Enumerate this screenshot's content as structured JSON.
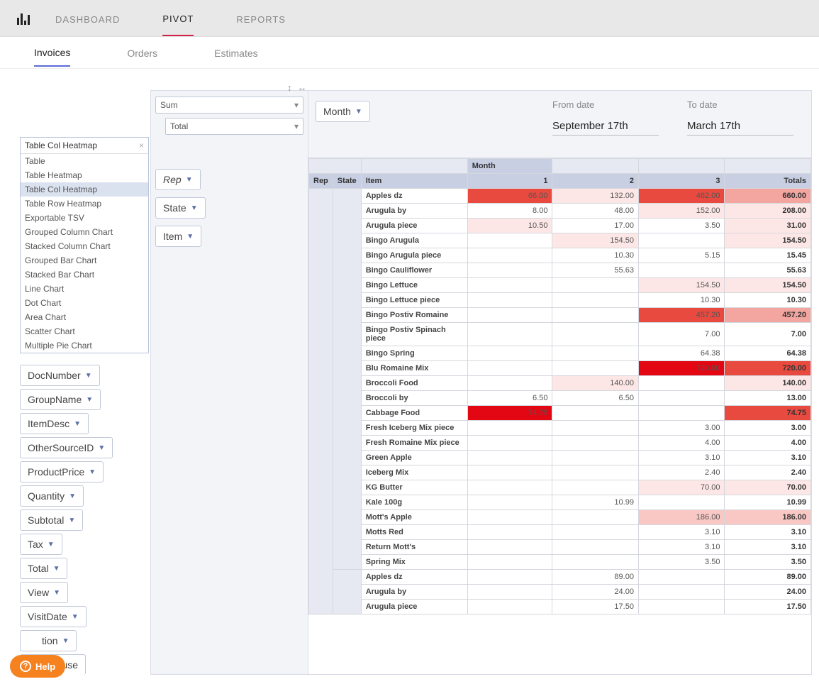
{
  "topnav": {
    "tabs": [
      "DASHBOARD",
      "PIVOT",
      "REPORTS"
    ],
    "active": 1
  },
  "subnav": {
    "tabs": [
      "Invoices",
      "Orders",
      "Estimates"
    ],
    "active": 0
  },
  "dates": {
    "from_label": "From date",
    "from_value": "September 17th",
    "to_label": "To date",
    "to_value": "March 17th"
  },
  "chart_type": {
    "selected": "Table Col Heatmap",
    "options": [
      "Table",
      "Table Heatmap",
      "Table Col Heatmap",
      "Table Row Heatmap",
      "Exportable TSV",
      "Grouped Column Chart",
      "Stacked Column Chart",
      "Grouped Bar Chart",
      "Stacked Bar Chart",
      "Line Chart",
      "Dot Chart",
      "Area Chart",
      "Scatter Chart",
      "Multiple Pie Chart"
    ],
    "highlight": 2
  },
  "available_fields": [
    "DocNumber",
    "GroupName",
    "ItemDesc",
    "OtherSourceID",
    "ProductPrice",
    "Quantity",
    "Subtotal",
    "Tax",
    "Total",
    "View",
    "VisitDate"
  ],
  "truncated_field": "tion",
  "cutoff_field": "Warehouse",
  "aggregator": {
    "func": "Sum",
    "field": "Total"
  },
  "row_fields": [
    "Rep",
    "State",
    "Item"
  ],
  "col_fields": [
    "Month"
  ],
  "pivot": {
    "month_label": "Month",
    "row_headers": [
      "Rep",
      "State",
      "Item"
    ],
    "cols": [
      "1",
      "2",
      "3"
    ],
    "totals_label": "Totals",
    "rows": [
      {
        "item": "Apples dz",
        "v": [
          "66.00",
          "132.00",
          "462.00"
        ],
        "t": "660.00",
        "h": [
          4,
          1,
          4
        ]
      },
      {
        "item": "Arugula by",
        "v": [
          "8.00",
          "48.00",
          "152.00"
        ],
        "t": "208.00",
        "h": [
          0,
          0,
          1
        ]
      },
      {
        "item": "Arugula piece",
        "v": [
          "10.50",
          "17.00",
          "3.50"
        ],
        "t": "31.00",
        "h": [
          1,
          0,
          0
        ]
      },
      {
        "item": "Bingo Arugula",
        "v": [
          "",
          "154.50",
          ""
        ],
        "t": "154.50",
        "h": [
          0,
          1,
          0
        ]
      },
      {
        "item": "Bingo Arugula piece",
        "v": [
          "",
          "10.30",
          "5.15"
        ],
        "t": "15.45",
        "h": [
          0,
          0,
          0
        ]
      },
      {
        "item": "Bingo Cauliflower",
        "v": [
          "",
          "55.63",
          ""
        ],
        "t": "55.63",
        "h": [
          0,
          0,
          0
        ]
      },
      {
        "item": "Bingo Lettuce",
        "v": [
          "",
          "",
          "154.50"
        ],
        "t": "154.50",
        "h": [
          0,
          0,
          1
        ]
      },
      {
        "item": "Bingo Lettuce piece",
        "v": [
          "",
          "",
          "10.30"
        ],
        "t": "10.30",
        "h": [
          0,
          0,
          0
        ]
      },
      {
        "item": "Bingo Postiv Romaine",
        "v": [
          "",
          "",
          "457.20"
        ],
        "t": "457.20",
        "h": [
          0,
          0,
          4
        ]
      },
      {
        "item": "Bingo Postiv Spinach piece",
        "v": [
          "",
          "",
          "7.00"
        ],
        "t": "7.00",
        "h": [
          0,
          0,
          0
        ]
      },
      {
        "item": "Bingo Spring",
        "v": [
          "",
          "",
          "64.38"
        ],
        "t": "64.38",
        "h": [
          0,
          0,
          0
        ]
      },
      {
        "item": "Blu Romaine Mix",
        "v": [
          "",
          "",
          "720.00"
        ],
        "t": "720.00",
        "h": [
          0,
          0,
          5
        ]
      },
      {
        "item": "Broccoli Food",
        "v": [
          "",
          "140.00",
          ""
        ],
        "t": "140.00",
        "h": [
          0,
          1,
          0
        ]
      },
      {
        "item": "Broccoli by",
        "v": [
          "6.50",
          "6.50",
          ""
        ],
        "t": "13.00",
        "h": [
          0,
          0,
          0
        ]
      },
      {
        "item": "Cabbage Food",
        "v": [
          "74.75",
          "",
          ""
        ],
        "t": "74.75",
        "h": [
          5,
          0,
          0
        ]
      },
      {
        "item": "Fresh Iceberg Mix piece",
        "v": [
          "",
          "",
          "3.00"
        ],
        "t": "3.00",
        "h": [
          0,
          0,
          0
        ]
      },
      {
        "item": "Fresh Romaine Mix piece",
        "v": [
          "",
          "",
          "4.00"
        ],
        "t": "4.00",
        "h": [
          0,
          0,
          0
        ]
      },
      {
        "item": "Green Apple",
        "v": [
          "",
          "",
          "3.10"
        ],
        "t": "3.10",
        "h": [
          0,
          0,
          0
        ]
      },
      {
        "item": "Iceberg Mix",
        "v": [
          "",
          "",
          "2.40"
        ],
        "t": "2.40",
        "h": [
          0,
          0,
          0
        ]
      },
      {
        "item": "KG Butter",
        "v": [
          "",
          "",
          "70.00"
        ],
        "t": "70.00",
        "h": [
          0,
          0,
          1
        ]
      },
      {
        "item": "Kale 100g",
        "v": [
          "",
          "10.99",
          ""
        ],
        "t": "10.99",
        "h": [
          0,
          0,
          0
        ]
      },
      {
        "item": "Mott's Apple",
        "v": [
          "",
          "",
          "186.00"
        ],
        "t": "186.00",
        "h": [
          0,
          0,
          2
        ]
      },
      {
        "item": "Motts Red",
        "v": [
          "",
          "",
          "3.10"
        ],
        "t": "3.10",
        "h": [
          0,
          0,
          0
        ]
      },
      {
        "item": "Return Mott's",
        "v": [
          "",
          "",
          "3.10"
        ],
        "t": "3.10",
        "h": [
          0,
          0,
          0
        ]
      },
      {
        "item": "Spring Mix",
        "v": [
          "",
          "",
          "3.50"
        ],
        "t": "3.50",
        "h": [
          0,
          0,
          0
        ]
      },
      {
        "item": "Apples dz",
        "v": [
          "",
          "89.00",
          ""
        ],
        "t": "89.00",
        "h": [
          0,
          0,
          0
        ],
        "newgroup": true
      },
      {
        "item": "Arugula by",
        "v": [
          "",
          "24.00",
          ""
        ],
        "t": "24.00",
        "h": [
          0,
          0,
          0
        ]
      },
      {
        "item": "Arugula piece",
        "v": [
          "",
          "17.50",
          ""
        ],
        "t": "17.50",
        "h": [
          0,
          0,
          0
        ]
      }
    ]
  },
  "help": "Help"
}
